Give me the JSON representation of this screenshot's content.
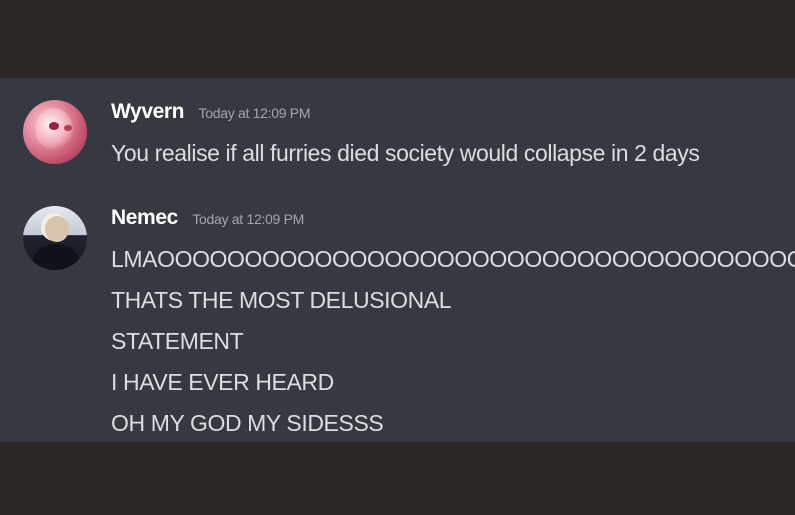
{
  "messages": [
    {
      "username": "Wyvern",
      "timestamp": "Today at 12:09 PM",
      "lines": [
        "You realise if all furries died society would collapse in 2 days"
      ]
    },
    {
      "username": "Nemec",
      "timestamp": "Today at 12:09 PM",
      "lines": [
        "LMAOOOOOOOOOOOOOOOOOOOOOOOOOOOOOOOOOOOOOOOOOO",
        "THATS THE MOST DELUSIONAL",
        "STATEMENT",
        "I HAVE EVER HEARD",
        "OH MY GOD MY SIDESSS"
      ]
    }
  ],
  "colors": {
    "page_background": "#2b2726",
    "chat_background": "#36393f",
    "username": "#ffffff",
    "timestamp": "#a3a6aa",
    "message_text": "#dcddde"
  },
  "icons": {
    "wyvern_avatar": "avatar-image",
    "nemec_avatar": "avatar-image"
  }
}
